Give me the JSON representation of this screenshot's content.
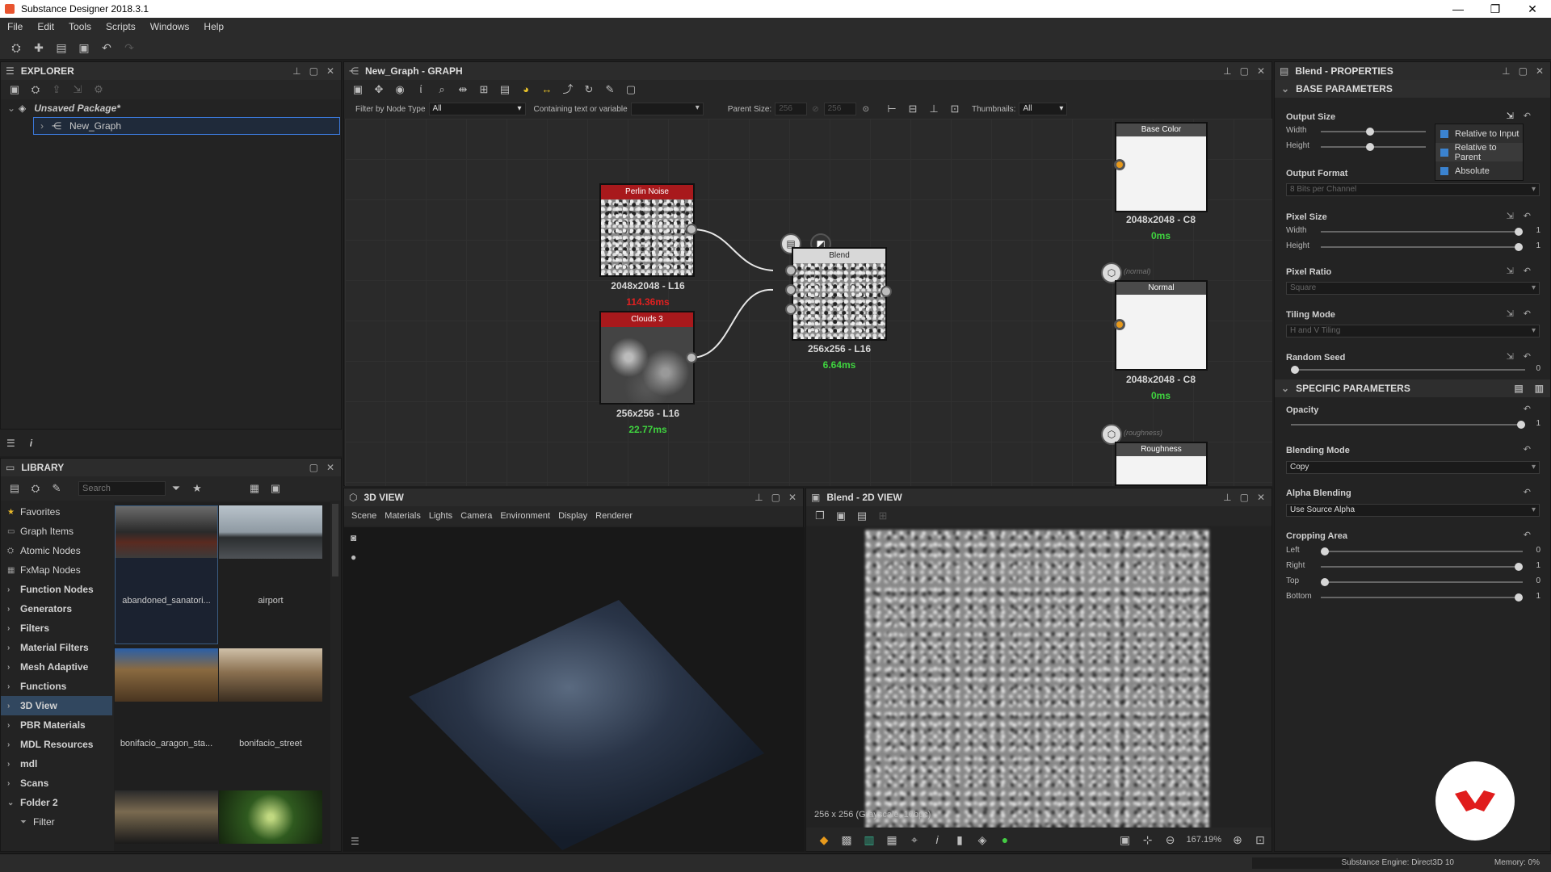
{
  "titlebar": {
    "title": "Substance Designer 2018.3.1",
    "min": "—",
    "restore": "❐",
    "close": "✕"
  },
  "menu": [
    "File",
    "Edit",
    "Tools",
    "Scripts",
    "Windows",
    "Help"
  ],
  "explorer": {
    "title": "EXPLORER",
    "package": "Unsaved Package*",
    "graph": "New_Graph"
  },
  "library": {
    "title": "LIBRARY",
    "search_placeholder": "Search",
    "categories": [
      {
        "label": "Favorites",
        "bold": false
      },
      {
        "label": "Graph Items",
        "bold": false
      },
      {
        "label": "Atomic Nodes",
        "bold": false
      },
      {
        "label": "FxMap Nodes",
        "bold": false
      },
      {
        "label": "Function Nodes",
        "bold": true
      },
      {
        "label": "Generators",
        "bold": true
      },
      {
        "label": "Filters",
        "bold": true
      },
      {
        "label": "Material Filters",
        "bold": true
      },
      {
        "label": "Mesh Adaptive",
        "bold": true
      },
      {
        "label": "Functions",
        "bold": true
      },
      {
        "label": "3D View",
        "bold": true
      },
      {
        "label": "PBR Materials",
        "bold": true
      },
      {
        "label": "MDL Resources",
        "bold": true
      },
      {
        "label": "mdl",
        "bold": true
      },
      {
        "label": "Scans",
        "bold": true
      },
      {
        "label": "Folder 2",
        "bold": true
      },
      {
        "label": "Filter",
        "bold": false
      }
    ],
    "thumbs": [
      "abandoned_sanatori...",
      "airport",
      "bonifacio_aragon_sta...",
      "bonifacio_street"
    ]
  },
  "graph": {
    "title": "New_Graph - GRAPH",
    "filter_label": "Filter by Node Type",
    "filter_value": "All",
    "containing_label": "Containing text or variable",
    "parent_size_label": "Parent Size:",
    "parent_size_w": "256",
    "parent_size_h": "256",
    "thumbnails_label": "Thumbnails:",
    "thumbnails_value": "All",
    "nodes": {
      "perlin": {
        "name": "Perlin Noise",
        "res": "2048x2048 - L16",
        "time": "114.36ms"
      },
      "clouds": {
        "name": "Clouds 3",
        "res": "256x256 - L16",
        "time": "22.77ms"
      },
      "blend": {
        "name": "Blend",
        "res": "256x256 - L16",
        "time": "6.64ms"
      },
      "basecolor": {
        "name": "Base Color",
        "res": "2048x2048 - C8",
        "time": "0ms"
      },
      "normal": {
        "name": "Normal",
        "tag": "(normal)",
        "res": "2048x2048 - C8",
        "time": "0ms"
      },
      "roughness": {
        "name": "Roughness",
        "tag": "(roughness)"
      }
    }
  },
  "view3d": {
    "title": "3D VIEW",
    "menu": [
      "Scene",
      "Materials",
      "Lights",
      "Camera",
      "Environment",
      "Display",
      "Renderer"
    ]
  },
  "view2d": {
    "title": "Blend - 2D VIEW",
    "info": "256 x 256 (Grayscale, 16bpc)",
    "zoom": "167.19%"
  },
  "properties": {
    "title": "Blend - PROPERTIES",
    "base_section": "BASE PARAMETERS",
    "specific_section": "SPECIFIC PARAMETERS",
    "output_size": "Output Size",
    "width": "Width",
    "height": "Height",
    "output_format": "Output Format",
    "output_format_value": "8 Bits per Channel",
    "pixel_size": "Pixel Size",
    "pixel_w": "1",
    "pixel_h": "1",
    "pixel_ratio": "Pixel Ratio",
    "pixel_ratio_value": "Square",
    "tiling_mode": "Tiling Mode",
    "tiling_value": "H and V Tiling",
    "random_seed": "Random Seed",
    "random_seed_value": "0",
    "opacity": "Opacity",
    "opacity_value": "1",
    "blending_mode": "Blending Mode",
    "blending_value": "Copy",
    "alpha_blending": "Alpha Blending",
    "alpha_value": "Use Source Alpha",
    "cropping": "Cropping Area",
    "left": "Left",
    "left_v": "0",
    "right": "Right",
    "right_v": "1",
    "top": "Top",
    "top_v": "0",
    "bottom": "Bottom",
    "bottom_v": "1",
    "popup": [
      "Relative to Input",
      "Relative to Parent",
      "Absolute"
    ]
  },
  "status": {
    "engine": "Substance Engine: Direct3D 10",
    "memory": "Memory: 0%"
  },
  "colors": {
    "accent": "#3b78d8",
    "node_red": "#a8191c",
    "time_red": "#e02020",
    "time_green": "#3fd43f"
  }
}
